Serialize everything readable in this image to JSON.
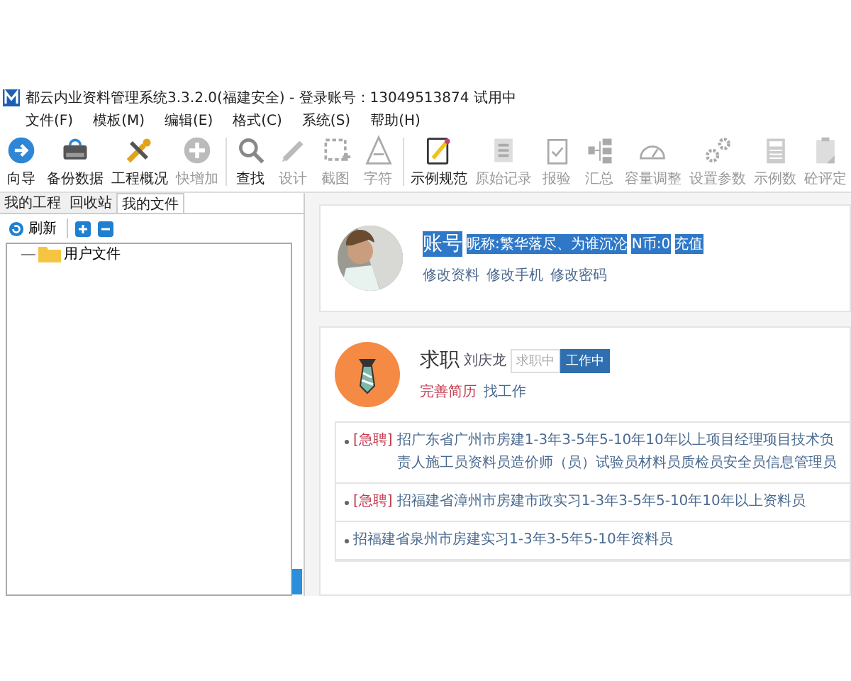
{
  "window": {
    "title": "都云内业资料管理系统3.3.2.0(福建安全) - 登录账号：13049513874 试用中"
  },
  "menu": [
    "文件(F)",
    "模板(M)",
    "编辑(E)",
    "格式(C)",
    "系统(S)",
    "帮助(H)"
  ],
  "toolbar": [
    {
      "label": "向导",
      "disabled": false
    },
    {
      "label": "备份数据",
      "disabled": false
    },
    {
      "label": "工程概况",
      "disabled": false
    },
    {
      "label": "快增加",
      "disabled": true
    },
    {
      "label": "查找",
      "disabled": false
    },
    {
      "label": "设计",
      "disabled": true
    },
    {
      "label": "截图",
      "disabled": true
    },
    {
      "label": "字符",
      "disabled": true
    },
    {
      "label": "示例规范",
      "disabled": false
    },
    {
      "label": "原始记录",
      "disabled": true
    },
    {
      "label": "报验",
      "disabled": true
    },
    {
      "label": "汇总",
      "disabled": true
    },
    {
      "label": "容量调整",
      "disabled": true
    },
    {
      "label": "设置参数",
      "disabled": true
    },
    {
      "label": "示例数",
      "disabled": true
    },
    {
      "label": "砼评定",
      "disabled": true
    }
  ],
  "sidebar": {
    "tabs": [
      {
        "label": "我的工程",
        "selected": false
      },
      {
        "label": "回收站",
        "selected": false
      },
      {
        "label": "我的文件",
        "selected": true
      }
    ],
    "refresh": "刷新",
    "tree": [
      {
        "label": "用户文件"
      }
    ]
  },
  "account": {
    "label": "账号",
    "nickname": "昵称:繁华落尽、为谁沉沦",
    "coins": "N币:0",
    "recharge": "充值",
    "highlighted": true,
    "links": [
      "修改资料",
      "修改手机",
      "修改密码"
    ]
  },
  "job": {
    "title": "求职",
    "name": "刘庆龙",
    "statuses": [
      {
        "label": "求职中",
        "selected": false
      },
      {
        "label": "工作中",
        "selected": true
      }
    ],
    "links": [
      {
        "label": "完善简历",
        "urgent": true
      },
      {
        "label": "找工作",
        "urgent": false
      }
    ],
    "listings": [
      {
        "urgent": true,
        "tag": "[急聘]",
        "text": "招广东省广州市房建1-3年3-5年5-10年10年以上项目经理项目技术负责人施工员资料员造价师（员）试验员材料员质检员安全员信息管理员"
      },
      {
        "urgent": true,
        "tag": "[急聘]",
        "text": "招福建省漳州市房建市政实习1-3年3-5年5-10年10年以上资料员"
      },
      {
        "urgent": false,
        "text": "招福建省泉州市房建实习1-3年3-5年5-10年资料员"
      }
    ]
  }
}
